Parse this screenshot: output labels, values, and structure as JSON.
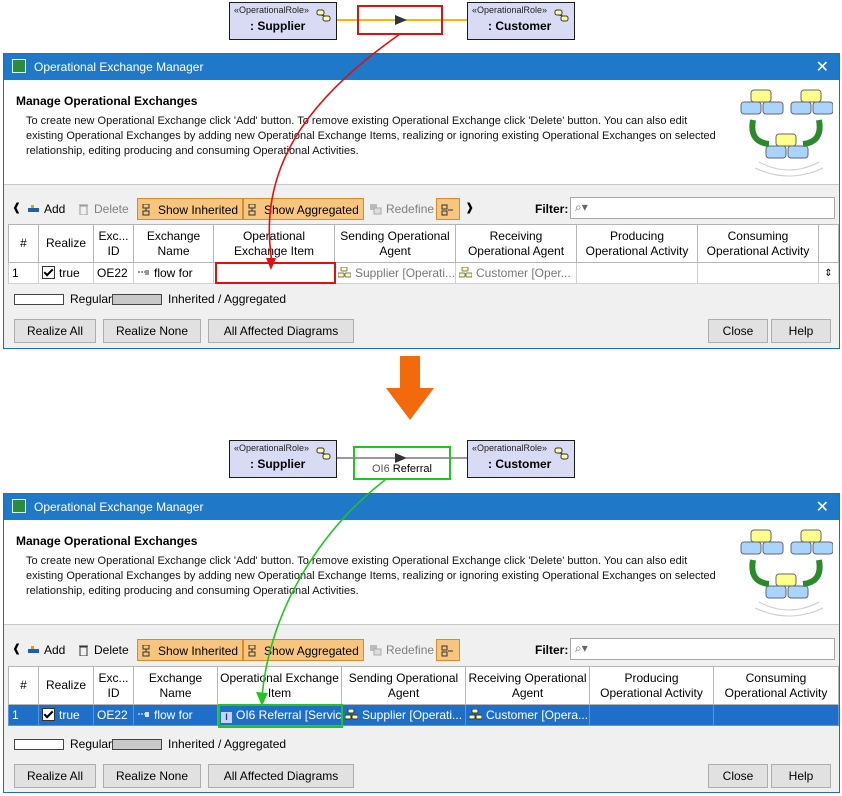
{
  "top_diagram": {
    "stereotype": "«OperationalRole»",
    "supplier": ": Supplier",
    "customer": ": Customer"
  },
  "bottom_diagram": {
    "stereotype": "«OperationalRole»",
    "supplier": ": Supplier",
    "customer": ": Customer",
    "item_prefix": "OI6",
    "item_name": "Referral"
  },
  "dialog": {
    "title": "Operational Exchange Manager",
    "close_glyph": "✕",
    "heading": "Manage Operational Exchanges",
    "description": "To create new Operational Exchange click 'Add' button. To remove existing Operational Exchange click 'Delete' button. You can also edit existing Operational Exchanges by adding new Operational Exchange Items, realizing or ignoring existing Operational Exchanges on selected relationship, editing producing and consuming Operational Activities.",
    "toolbar": {
      "add": "Add",
      "delete": "Delete",
      "show_inherited": "Show Inherited",
      "show_aggregated": "Show Aggregated",
      "redefine": "Redefine",
      "filter": "Filter:"
    },
    "columns": [
      "#",
      "Realize",
      "Exc... ID",
      "Exchange Name",
      "Operational Exchange Item",
      "Sending Operational Agent",
      "Receiving Operational Agent",
      "Producing Operational Activity",
      "Consuming Operational Activity"
    ],
    "legend": {
      "regular": "Regular",
      "inherited": "Inherited / Aggregated"
    },
    "buttons": {
      "realize_all": "Realize All",
      "realize_none": "Realize None",
      "all_affected": "All Affected Diagrams",
      "close": "Close",
      "help": "Help"
    }
  },
  "row_before": {
    "num": "1",
    "realize": "true",
    "id": "OE22",
    "name": "flow for",
    "item": "",
    "sending": "Supplier [Operati...",
    "receiving": "Customer [Oper..."
  },
  "row_after": {
    "num": "1",
    "realize": "true",
    "id": "OE22",
    "name": "flow for",
    "item": "OI6 Referral [Servic",
    "sending": "Supplier [Operati...",
    "receiving": "Customer [Opera..."
  },
  "colors": {
    "title_bar": "#1f78c8",
    "selection": "#1f6fc8",
    "highlight_red": "#e01010",
    "highlight_green": "#22c322",
    "arrow_orange": "#f26a0c",
    "toggle_active": "#f7c57e"
  }
}
